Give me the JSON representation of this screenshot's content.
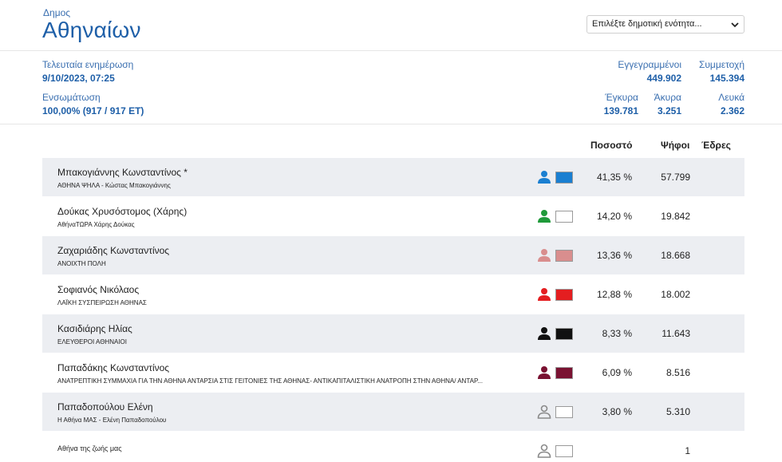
{
  "header": {
    "municipality_label": "Δημος",
    "municipality_name": "Αθηναίων",
    "unit_select_placeholder": "Επιλέξτε δημοτική ενότητα..."
  },
  "stats": {
    "last_update_label": "Τελευταία ενημέρωση",
    "last_update_value": "9/10/2023, 07:25",
    "incorporation_label": "Ενσωμάτωση",
    "incorporation_value": "100,00% (917 / 917 ΕΤ)",
    "registered_label": "Εγγεγραμμένοι",
    "registered_value": "449.902",
    "turnout_label": "Συμμετοχή",
    "turnout_value": "145.394",
    "valid_label": "Έγκυρα",
    "valid_value": "139.781",
    "invalid_label": "Άκυρα",
    "invalid_value": "3.251",
    "blank_label": "Λευκά",
    "blank_value": "2.362"
  },
  "table": {
    "col_percentage": "Ποσοστό",
    "col_votes": "Ψήφοι",
    "col_seats": "Έδρες",
    "rows": [
      {
        "name": "Μπακογιάννης Κωνσταντίνος *",
        "party": "ΑΘΗΝΑ ΨΗΛΑ - Κώστας Μπακογιάννης",
        "pct": "41,35 %",
        "votes": "57.799",
        "color": "#1a7fd1",
        "icon_color": "#1a7fd1"
      },
      {
        "name": "Δούκας Χρυσόστομος (Χάρης)",
        "party": "ΑθήναΤΩΡΑ Χάρης Δούκας",
        "pct": "14,20 %",
        "votes": "19.842",
        "color": "#ffffff",
        "icon_color": "#1f9a3a"
      },
      {
        "name": "Ζαχαριάδης Κωνσταντίνος",
        "party": "ΑΝΟΙΧΤΗ ΠΟΛΗ",
        "pct": "13,36 %",
        "votes": "18.668",
        "color": "#d98e8e",
        "icon_color": "#d98e8e"
      },
      {
        "name": "Σοφιανός Νικόλαος",
        "party": "ΛΑΪΚΗ ΣΥΣΠΕΙΡΩΣΗ ΑΘΗΝΑΣ",
        "pct": "12,88 %",
        "votes": "18.002",
        "color": "#e41e20",
        "icon_color": "#e41e20"
      },
      {
        "name": "Κασιδιάρης Ηλίας",
        "party": "ΕΛΕΥΘΕΡΟΙ ΑΘΗΝΑΙΟΙ",
        "pct": "8,33 %",
        "votes": "11.643",
        "color": "#111111",
        "icon_color": "#111111"
      },
      {
        "name": "Παπαδάκης Κωνσταντίνος",
        "party": "ΑΝΑΤΡΕΠΤΙΚΗ ΣΥΜΜΑΧΙΑ ΓΙΑ ΤΗΝ ΑΘΗΝΑ ΑΝΤΑΡΣΙΑ ΣΤΙΣ ΓΕΙΤΟΝΙΕΣ ΤΗΣ ΑΘΗΝΑΣ- ΑΝΤΙΚΑΠΙΤΑΛΙΣΤΙΚΗ ΑΝΑΤΡΟΠΗ ΣΤΗΝ ΑΘΗΝΑ/ ΑΝΤΑΡ...",
        "pct": "6,09 %",
        "votes": "8.516",
        "color": "#7a1232",
        "icon_color": "#7a1232"
      },
      {
        "name": "Παπαδοπούλου Ελένη",
        "party": "Η Αθήνα ΜΑΣ - Ελένη Παπαδοπούλου",
        "pct": "3,80 %",
        "votes": "5.310",
        "color": "#ffffff",
        "icon_color": "#8a8a8a"
      },
      {
        "name": "Αθήνα της ζωής μας",
        "party": "",
        "pct": "",
        "votes": "1",
        "color": "#ffffff",
        "icon_color": "#8a8a8a"
      }
    ]
  }
}
